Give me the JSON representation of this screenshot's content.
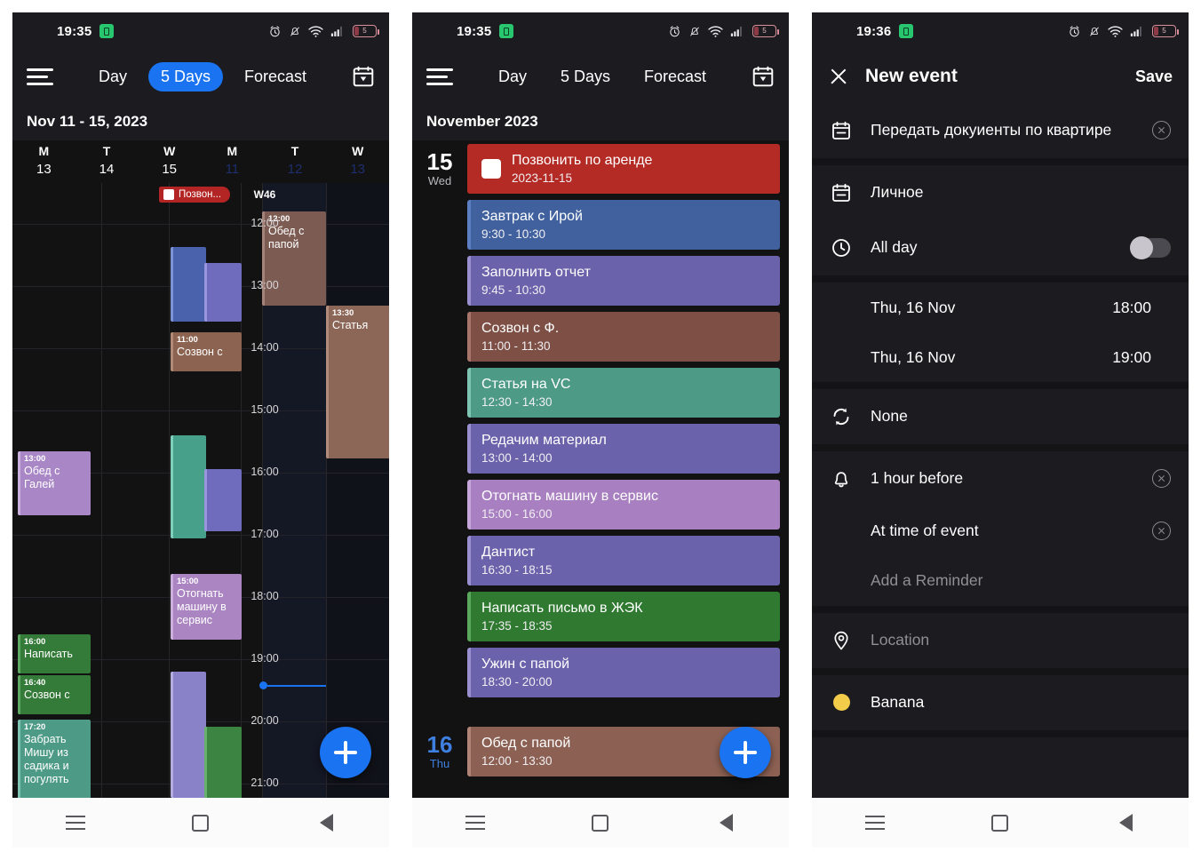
{
  "status_bar": {
    "time_left": "19:35",
    "time_right": "19:36",
    "battery_level": "5",
    "icons": [
      "alarm-icon",
      "bell-off-icon",
      "wifi-icon",
      "signal-icon",
      "battery-icon"
    ]
  },
  "panel1": {
    "tabs": [
      {
        "label": "Day",
        "active": false
      },
      {
        "label": "5 Days",
        "active": true
      },
      {
        "label": "Forecast",
        "active": false
      }
    ],
    "range_title": "Nov 11 - 15, 2023",
    "week_number": "W46",
    "day_headers": [
      {
        "dow": "M",
        "num": "13",
        "dim": false
      },
      {
        "dow": "T",
        "num": "14",
        "dim": false
      },
      {
        "dow": "W",
        "num": "15",
        "dim": false
      },
      {
        "dow": "M",
        "num": "11",
        "dim": true
      },
      {
        "dow": "T",
        "num": "12",
        "dim": true
      },
      {
        "dow": "W",
        "num": "13",
        "dim": true
      }
    ],
    "time_labels": [
      "12:00",
      "13:00",
      "14:00",
      "15:00",
      "16:00",
      "17:00",
      "18:00",
      "19:00",
      "20:00",
      "21:00"
    ],
    "allday_chip": "Позвон...",
    "events": [
      {
        "time": "12:00",
        "name": "Обед с папой",
        "color": "#7b5b52"
      },
      {
        "time": "13:30",
        "name": "Статья",
        "color": "#8c6657"
      },
      {
        "time": "11:00",
        "name": "Созвон с",
        "color": "#8c6350"
      },
      {
        "time": "13:00",
        "name": "Обед с Галей",
        "color": "#a987c7"
      },
      {
        "time": "15:00",
        "name": "Отогнать машину в сервис",
        "color": "#ab85c2"
      },
      {
        "time": "16:00",
        "name": "Написать",
        "color": "#347a38"
      },
      {
        "time": "16:40",
        "name": "Созвон с",
        "color": "#347a38"
      },
      {
        "time": "17:20",
        "name": "Забрать Мишу из садика и погулять",
        "color": "#4d9a87"
      }
    ],
    "fab_label": "+"
  },
  "panel2": {
    "tabs": [
      {
        "label": "Day",
        "active": false
      },
      {
        "label": "5 Days",
        "active": false
      },
      {
        "label": "Forecast",
        "active": false
      }
    ],
    "month_title": "November 2023",
    "days": [
      {
        "day_num": "15",
        "day_week": "Wed",
        "is_next": false,
        "events": [
          {
            "title": "Позвонить по аренде",
            "time": "2023-11-15",
            "color": "#b42a24",
            "accent": "#b42a24",
            "checkbox": true
          },
          {
            "title": "Завтрак с Ирой",
            "time": "9:30 - 10:30",
            "color": "#40619e",
            "accent": "#5c7fc4",
            "checkbox": false
          },
          {
            "title": "Заполнить отчет",
            "time": "9:45 - 10:30",
            "color": "#6a63ab",
            "accent": "#9a8fd1",
            "checkbox": false
          },
          {
            "title": "Созвон с Ф.",
            "time": "11:00 - 11:30",
            "color": "#7d4f45",
            "accent": "#a8756a",
            "checkbox": false
          },
          {
            "title": "Статья на VC",
            "time": "12:30 - 14:30",
            "color": "#4d9a87",
            "accent": "#7dc4b1",
            "checkbox": false
          },
          {
            "title": "Редачим материал",
            "time": "13:00 - 14:00",
            "color": "#6a63ab",
            "accent": "#9a8fd1",
            "checkbox": false
          },
          {
            "title": "Отогнать машину в сервис",
            "time": "15:00 - 16:00",
            "color": "#a87fc0",
            "accent": "#c6a6d9",
            "checkbox": false
          },
          {
            "title": "Дантист",
            "time": "16:30 - 18:15",
            "color": "#6a63ab",
            "accent": "#9a8fd1",
            "checkbox": false
          },
          {
            "title": "Написать письмо в ЖЭК",
            "time": "17:35 - 18:35",
            "color": "#2f7a30",
            "accent": "#5aa85b",
            "checkbox": false
          },
          {
            "title": "Ужин с папой",
            "time": "18:30 - 20:00",
            "color": "#6a63ab",
            "accent": "#9a8fd1",
            "checkbox": false
          }
        ]
      },
      {
        "day_num": "16",
        "day_week": "Thu",
        "is_next": true,
        "events": [
          {
            "title": "Обед с папой",
            "time": "12:00 - 13:30",
            "color": "#8c6153",
            "accent": "#b08476",
            "checkbox": false
          }
        ]
      }
    ],
    "fab_label": "+"
  },
  "panel3": {
    "close_label": "close-icon",
    "title": "New event",
    "save_label": "Save",
    "event_title": "Передать докуиенты по квартире",
    "calendar_name": "Личное",
    "all_day_label": "All day",
    "all_day_on": false,
    "start_date": "Thu, 16 Nov",
    "start_time": "18:00",
    "end_date": "Thu, 16 Nov",
    "end_time": "19:00",
    "repeat_label": "None",
    "reminders": [
      {
        "label": "1 hour before",
        "clearable": true,
        "has_icon": true
      },
      {
        "label": "At time of event",
        "clearable": true,
        "has_icon": false
      }
    ],
    "add_reminder_label": "Add a Reminder",
    "location_placeholder": "Location",
    "color_label": "Banana",
    "color_value": "#f3cc4a"
  },
  "nav_bar": {
    "items": [
      "menu-icon",
      "home-icon",
      "back-icon"
    ]
  },
  "theme": {
    "accent": "#1a73f0",
    "bg_dark": "#121212",
    "bar_dark": "#1c1b1f",
    "page_bg": "#ffffff"
  }
}
